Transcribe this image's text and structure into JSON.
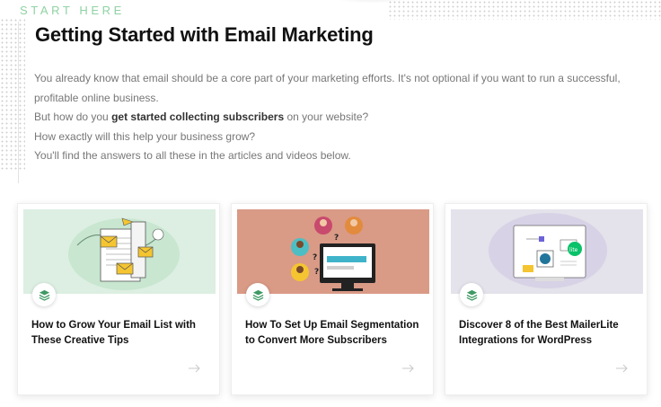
{
  "eyebrow": "START HERE",
  "title": "Getting Started with Email Marketing",
  "intro": {
    "p1": "You already know that email should be a core part of your marketing efforts. It's not optional if you want to run a successful, profitable online business.",
    "p2_before": "But how do you ",
    "p2_bold": "get started collecting subscribers",
    "p2_after": " on your website?",
    "p3": "How exactly will this help your business grow?",
    "p4": "You'll find the answers to all these in the articles and videos below."
  },
  "cards": [
    {
      "title": "How to Grow Your Email List with These Creative Tips",
      "image_bg": "#d9ecdf",
      "icon": "layers-icon"
    },
    {
      "title": "How To Set Up Email Segmentation to Convert More Subscribers",
      "image_bg": "#d99a86",
      "icon": "layers-icon"
    },
    {
      "title": "Discover 8 of the Best MailerLite Integrations for WordPress",
      "image_bg": "#e4e2ea",
      "icon": "layers-icon"
    }
  ],
  "colors": {
    "accent": "#8fd2a3",
    "badge_icon": "#3f9a63"
  }
}
